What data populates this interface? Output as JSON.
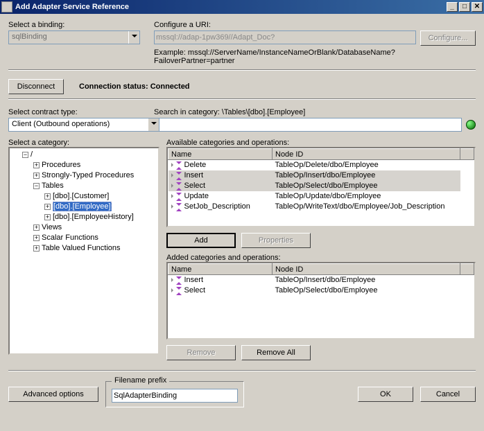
{
  "title": "Add Adapter Service Reference",
  "labels": {
    "select_binding": "Select a binding:",
    "configure_uri": "Configure a URI:",
    "example": "Example: mssql://ServerName/InstanceNameOrBlank/DatabaseName?FailoverPartner=partner",
    "connection_status_label": "Connection status:",
    "connection_status_value": "Connected",
    "select_contract": "Select contract type:",
    "search_in_category": "Search in category: \\Tables\\[dbo].[Employee]",
    "select_category": "Select a category:",
    "available": "Available categories and operations:",
    "added": "Added categories and operations:",
    "filename_prefix": "Filename prefix"
  },
  "binding_value": "sqlBinding",
  "uri_value": "mssql://adap-1pw369//Adapt_Doc?",
  "contract_value": "Client (Outbound operations)",
  "search_value": "",
  "filename_value": "SqlAdapterBinding",
  "buttons": {
    "configure": "Configure...",
    "disconnect": "Disconnect",
    "add": "Add",
    "properties": "Properties",
    "remove": "Remove",
    "remove_all": "Remove All",
    "advanced": "Advanced options",
    "ok": "OK",
    "cancel": "Cancel"
  },
  "columns": {
    "name": "Name",
    "node_id": "Node ID"
  },
  "tree": {
    "root": "/",
    "procedures": "Procedures",
    "stp": "Strongly-Typed Procedures",
    "tables": "Tables",
    "tbl_customer": "[dbo].[Customer]",
    "tbl_employee": "[dbo].[Employee]",
    "tbl_emphist": "[dbo].[EmployeeHistory]",
    "views": "Views",
    "scalar_fn": "Scalar Functions",
    "tvf": "Table Valued Functions"
  },
  "available_ops": [
    {
      "name": "Delete",
      "node_id": "TableOp/Delete/dbo/Employee",
      "selected": false
    },
    {
      "name": "Insert",
      "node_id": "TableOp/Insert/dbo/Employee",
      "selected": true
    },
    {
      "name": "Select",
      "node_id": "TableOp/Select/dbo/Employee",
      "selected": true
    },
    {
      "name": "Update",
      "node_id": "TableOp/Update/dbo/Employee",
      "selected": false
    },
    {
      "name": "SetJob_Description",
      "node_id": "TableOp/WriteText/dbo/Employee/Job_Description",
      "selected": false
    }
  ],
  "added_ops": [
    {
      "name": "Insert",
      "node_id": "TableOp/Insert/dbo/Employee"
    },
    {
      "name": "Select",
      "node_id": "TableOp/Select/dbo/Employee"
    }
  ]
}
